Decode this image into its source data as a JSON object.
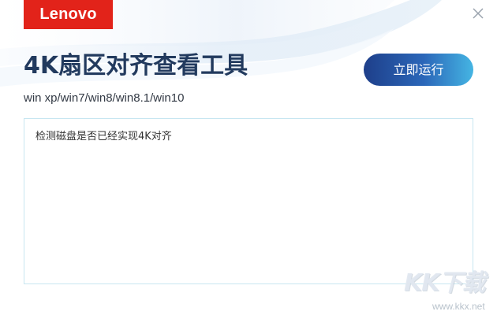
{
  "brand": {
    "logo_text": "Lenovo",
    "logo_color": "#e2231a"
  },
  "header": {
    "title": "4K扇区对齐查看工具",
    "subtitle": "win xp/win7/win8/win8.1/win10"
  },
  "actions": {
    "run_label": "立即运行",
    "close_icon": "close-icon"
  },
  "output": {
    "value": "检测磁盘是否已经实现4K对齐"
  },
  "watermark": {
    "text": "KK下载",
    "url": "www.kkx.net"
  },
  "colors": {
    "title": "#223a5e",
    "button_start": "#1e3f8a",
    "button_end": "#45b5e3",
    "border": "#c7e6f1"
  }
}
